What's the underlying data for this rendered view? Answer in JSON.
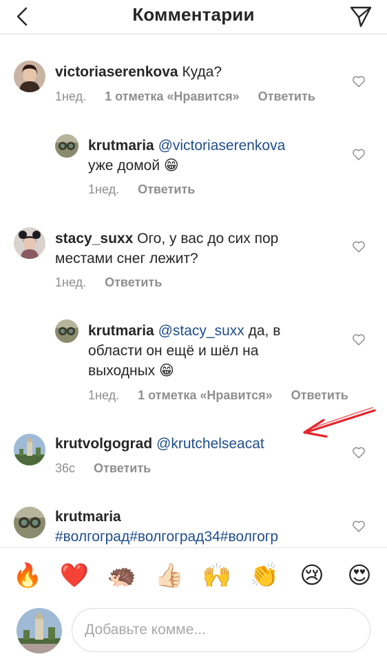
{
  "header": {
    "title": "Комментарии",
    "back_icon": "chevron-left-icon",
    "send_icon": "paper-plane-icon"
  },
  "comments": [
    {
      "user": "victoriaserenkova",
      "text": "Куда?",
      "time": "1нед.",
      "likes": "1 отметка «Нравится»",
      "reply": "Ответить"
    },
    {
      "user": "krutmaria",
      "mention": "@victoriaserenkova",
      "text": "уже домой 😁",
      "time": "1нед.",
      "reply": "Ответить"
    },
    {
      "user": "stacy_suxx",
      "text_line1": "Ого, у вас до сих пор",
      "text_line2": "местами снег лежит?",
      "time": "1нед.",
      "reply": "Ответить"
    },
    {
      "user": "krutmaria",
      "mention": "@stacy_suxx",
      "text_line1": "да, в",
      "text_line2": "области он ещё и шёл на",
      "text_line3": "выходных 😁",
      "time": "1нед.",
      "likes": "1 отметка «Нравится»",
      "reply": "Ответить"
    },
    {
      "user": "krutvolgograd",
      "mention": "@krutchelseacat",
      "time": "36с",
      "reply": "Ответить"
    },
    {
      "user": "krutmaria",
      "tags": "#волгоград#волгоград34#волгогр"
    }
  ],
  "emoji_bar": [
    "🔥",
    "❤️",
    "🦔",
    "👍🏻",
    "🙌",
    "👏",
    "😢",
    "😍"
  ],
  "compose": {
    "placeholder": "Добавьте комме..."
  },
  "colors": {
    "mention": "#1f4d8c",
    "muted": "#8e8e8e",
    "annotation_arrow": "#e8232a"
  }
}
